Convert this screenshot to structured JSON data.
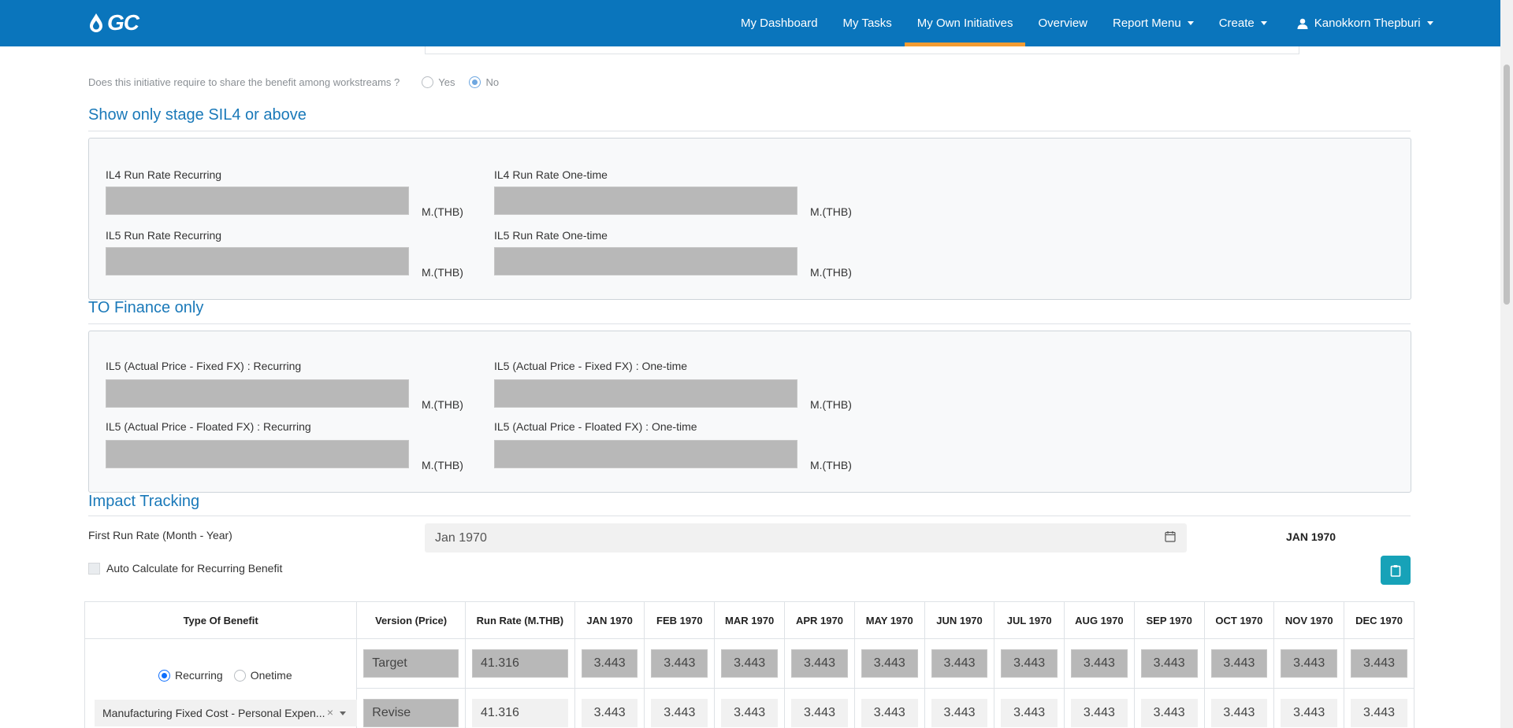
{
  "navbar": {
    "logo_text": "GC",
    "items": [
      {
        "label": "My Dashboard",
        "active": false,
        "dropdown": false
      },
      {
        "label": "My Tasks",
        "active": false,
        "dropdown": false
      },
      {
        "label": "My Own Initiatives",
        "active": true,
        "dropdown": false
      },
      {
        "label": "Overview",
        "active": false,
        "dropdown": false
      },
      {
        "label": "Report Menu",
        "active": false,
        "dropdown": true
      },
      {
        "label": "Create",
        "active": false,
        "dropdown": true
      }
    ],
    "user_name": "Kanokkorn Thepburi",
    "colors": {
      "background": "#0a75bc",
      "active_underline": "#f39c32"
    }
  },
  "share_benefit": {
    "question": "Does this initiative require to share the benefit among workstreams ?",
    "options": [
      "Yes",
      "No"
    ],
    "selected": "No"
  },
  "sil4_section": {
    "title": "Show only stage SIL4 or above",
    "fields": [
      {
        "label": "IL4 Run Rate Recurring",
        "value": "",
        "unit": "M.(THB)"
      },
      {
        "label": "IL4 Run Rate One-time",
        "value": "",
        "unit": "M.(THB)"
      },
      {
        "label": "IL5 Run Rate Recurring",
        "value": "",
        "unit": "M.(THB)"
      },
      {
        "label": "IL5 Run Rate One-time",
        "value": "",
        "unit": "M.(THB)"
      }
    ]
  },
  "finance_section": {
    "title": "TO Finance only",
    "fields": [
      {
        "label": "IL5 (Actual Price - Fixed FX) : Recurring",
        "value": "",
        "unit": "M.(THB)"
      },
      {
        "label": "IL5 (Actual Price - Fixed FX) : One-time",
        "value": "",
        "unit": "M.(THB)"
      },
      {
        "label": "IL5 (Actual Price - Floated FX) : Recurring",
        "value": "",
        "unit": "M.(THB)"
      },
      {
        "label": "IL5 (Actual Price - Floated FX) : One-time",
        "value": "",
        "unit": "M.(THB)"
      }
    ]
  },
  "impact_tracking": {
    "title": "Impact Tracking",
    "first_run_label": "First Run Rate (Month - Year)",
    "first_run_value": "Jan 1970",
    "first_run_display": "JAN 1970",
    "auto_calc_label": "Auto Calculate for Recurring Benefit",
    "auto_calc_checked": false
  },
  "benefit_table": {
    "headers": {
      "type": "Type Of Benefit",
      "version": "Version (Price)",
      "run_rate": "Run Rate (M.THB)",
      "months": [
        "JAN 1970",
        "FEB 1970",
        "MAR 1970",
        "APR 1970",
        "MAY 1970",
        "JUN 1970",
        "JUL 1970",
        "AUG 1970",
        "SEP 1970",
        "OCT 1970",
        "NOV 1970",
        "DEC 1970"
      ]
    },
    "benefit_type_options": [
      "Recurring",
      "Onetime"
    ],
    "benefit_type_selected": "Recurring",
    "benefit_category": "Manufacturing Fixed Cost - Personal Expen...",
    "rows": [
      {
        "version": "Target",
        "run_rate": "41.316",
        "values": [
          "3.443",
          "3.443",
          "3.443",
          "3.443",
          "3.443",
          "3.443",
          "3.443",
          "3.443",
          "3.443",
          "3.443",
          "3.443",
          "3.443"
        ],
        "readonly": true
      },
      {
        "version": "Revise",
        "run_rate": "41.316",
        "values": [
          "3.443",
          "3.443",
          "3.443",
          "3.443",
          "3.443",
          "3.443",
          "3.443",
          "3.443",
          "3.443",
          "3.443",
          "3.443",
          "3.443"
        ],
        "readonly": false
      }
    ]
  },
  "colors": {
    "section_title": "#1a79b9",
    "readonly_field": "#b8b8b8",
    "action_button": "#17a2b8"
  },
  "icons": [
    "water-drop-icon",
    "user-icon",
    "calendar-icon",
    "clipboard-icon",
    "clear-icon",
    "chevron-down-icon"
  ]
}
